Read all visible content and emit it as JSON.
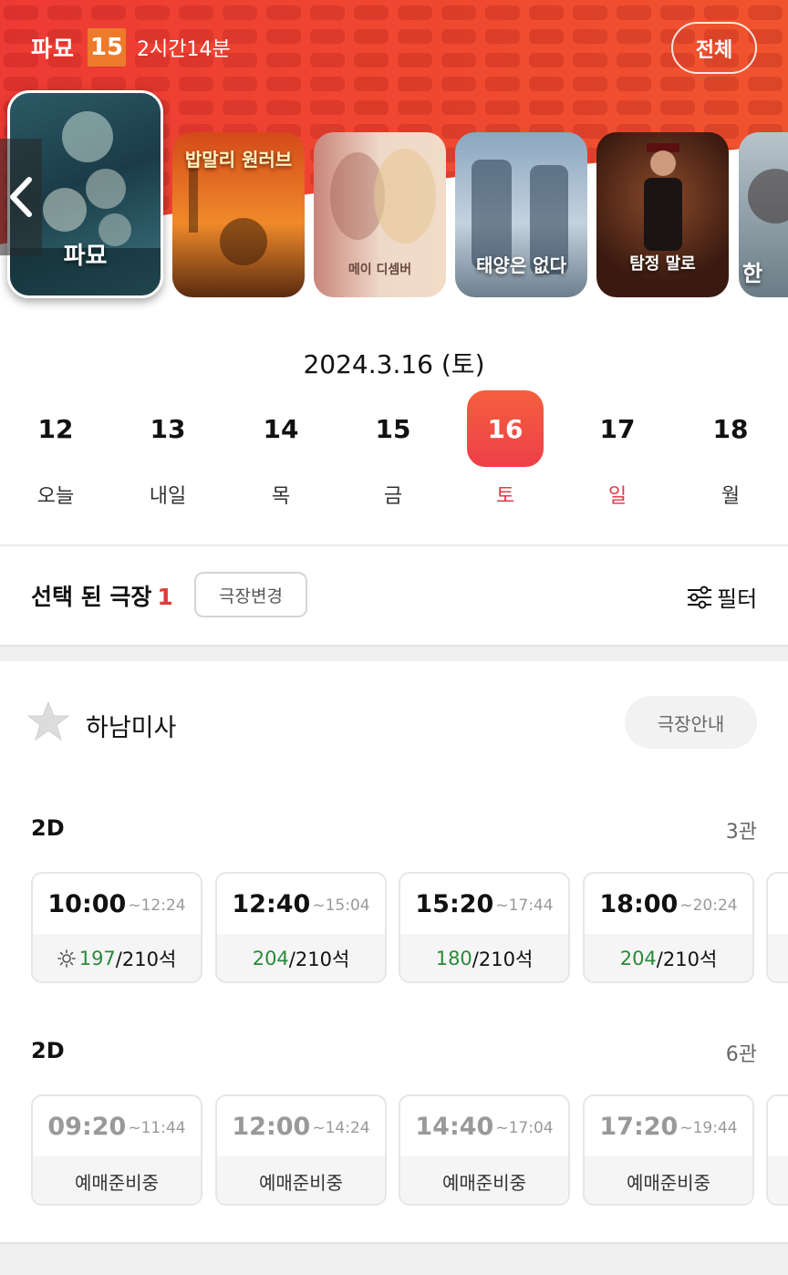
{
  "header": {
    "movie_title": "파묘",
    "rating": "15",
    "runtime": "2시간14분",
    "all_button": "전체",
    "colors": {
      "primary": "#ee3f2d",
      "rating_bg": "#ee7a2c"
    }
  },
  "posters": [
    {
      "title": "파묘",
      "selected": true
    },
    {
      "title": "밥말리 원러브",
      "selected": false
    },
    {
      "title": "메이 디셈버",
      "selected": false
    },
    {
      "title": "태양은 없다",
      "selected": false
    },
    {
      "title": "탐정 말로",
      "selected": false
    },
    {
      "title": "한",
      "selected": false
    }
  ],
  "date": {
    "title": "2024.3.16 (토)",
    "days": [
      {
        "num": "12",
        "label": "오늘"
      },
      {
        "num": "13",
        "label": "내일"
      },
      {
        "num": "14",
        "label": "목"
      },
      {
        "num": "15",
        "label": "금"
      },
      {
        "num": "16",
        "label": "토"
      },
      {
        "num": "17",
        "label": "일"
      },
      {
        "num": "18",
        "label": "월"
      }
    ]
  },
  "theater_bar": {
    "selected_label": "선택 된 극장",
    "selected_count": "1",
    "change_button": "극장변경",
    "filter_label": "필터"
  },
  "cinema": {
    "name": "하남미사",
    "info_button": "극장안내",
    "screens": [
      {
        "format": "2D",
        "hall": "3관",
        "slots": [
          {
            "start": "10:00",
            "end": "~12:24",
            "available": "197",
            "total": "/210석",
            "morning": true
          },
          {
            "start": "12:40",
            "end": "~15:04",
            "available": "204",
            "total": "/210석"
          },
          {
            "start": "15:20",
            "end": "~17:44",
            "available": "180",
            "total": "/210석"
          },
          {
            "start": "18:00",
            "end": "~20:24",
            "available": "204",
            "total": "/210석"
          }
        ]
      },
      {
        "format": "2D",
        "hall": "6관",
        "slots": [
          {
            "start": "09:20",
            "end": "~11:44",
            "status": "예매준비중"
          },
          {
            "start": "12:00",
            "end": "~14:24",
            "status": "예매준비중"
          },
          {
            "start": "14:40",
            "end": "~17:04",
            "status": "예매준비중"
          },
          {
            "start": "17:20",
            "end": "~19:44",
            "status": "예매준비중"
          }
        ]
      }
    ]
  }
}
